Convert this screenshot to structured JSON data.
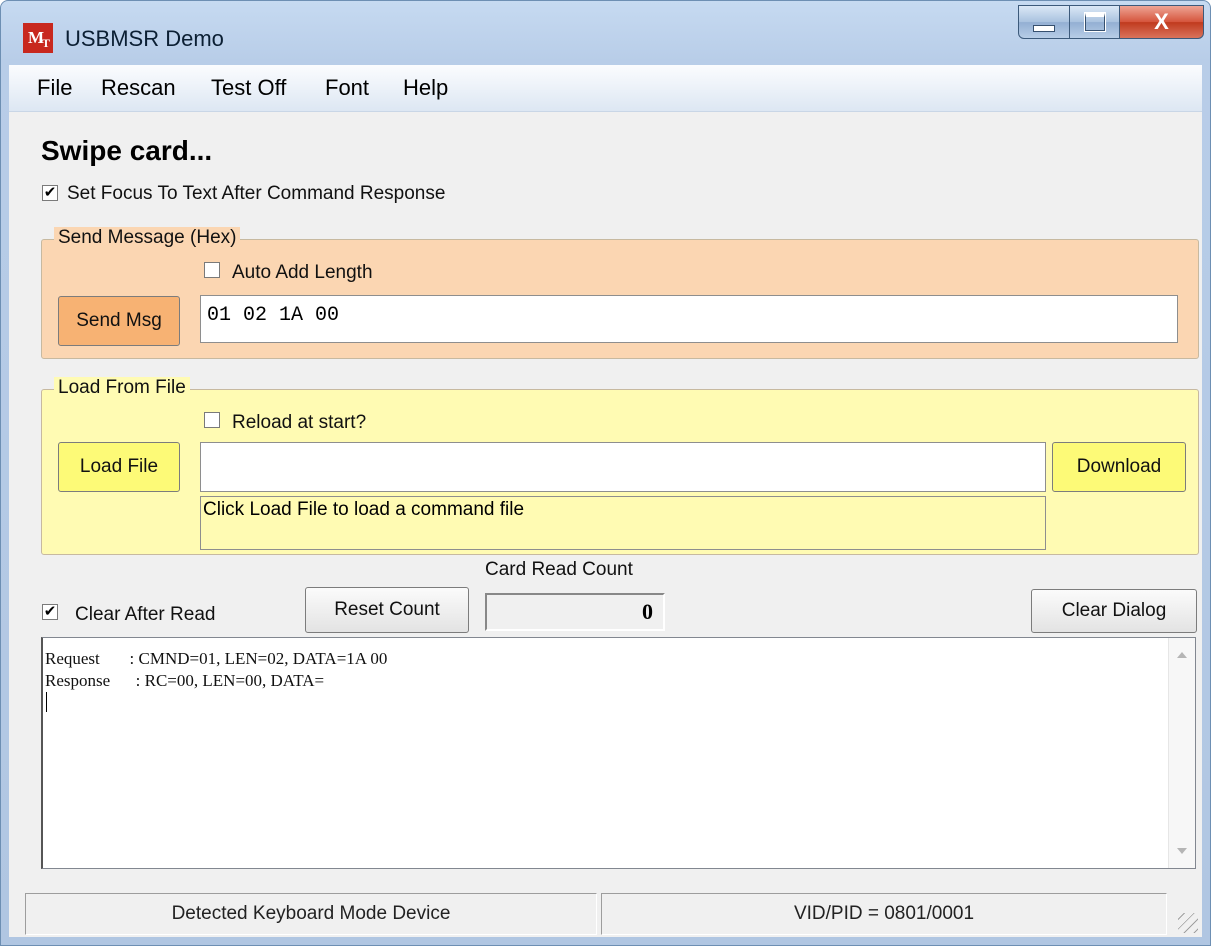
{
  "window": {
    "title": "USBMSR Demo",
    "icon_text_m": "M",
    "icon_text_t": "T",
    "close_glyph": "X"
  },
  "menu": {
    "items": [
      "File",
      "Rescan",
      "Test Off",
      "Font",
      "Help"
    ]
  },
  "status_title": "Swipe card...",
  "focus_checkbox": {
    "label": "Set Focus To Text After Command Response",
    "checked": true,
    "mark": "✔"
  },
  "send_group": {
    "title": "Send Message (Hex)",
    "auto_add_length_label": "Auto Add Length",
    "button": "Send Msg",
    "message": "01 02 1A 00",
    "bg_color": "#fbd6b2"
  },
  "load_group": {
    "title": "Load From File",
    "reload_label": "Reload at start?",
    "load_button": "Load File",
    "file_path": "",
    "download_button": "Download",
    "info_text": "Click Load File to load a command file",
    "bg_color": "#fffbb3"
  },
  "card_read": {
    "clear_after_read_label": "Clear After Read",
    "clear_after_read_mark": "✔",
    "reset_button": "Reset Count",
    "count_label": "Card Read Count",
    "count": "0",
    "clear_dialog_button": "Clear Dialog"
  },
  "log": {
    "lines": [
      "Request       : CMND=01, LEN=02, DATA=1A 00",
      "Response      : RC=00, LEN=00, DATA="
    ]
  },
  "statusbar": {
    "left": "Detected Keyboard Mode Device",
    "right": "VID/PID = 0801/0001"
  }
}
